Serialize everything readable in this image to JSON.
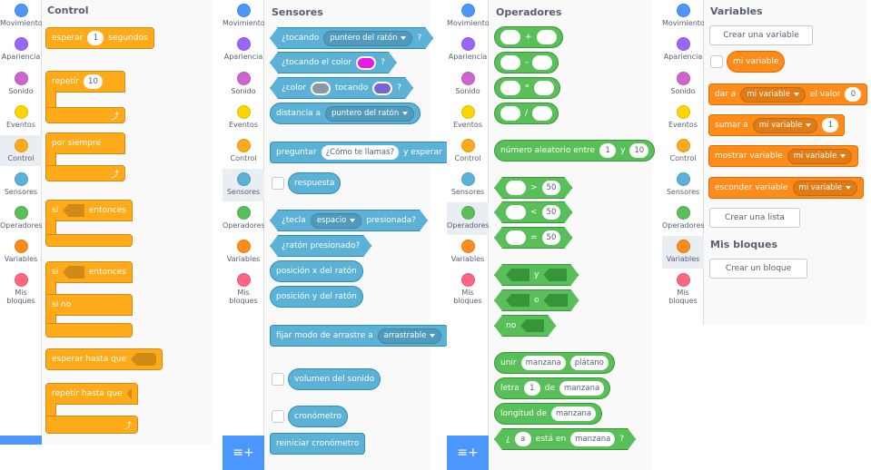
{
  "categories": [
    {
      "label": "Movimiento",
      "color": "#4c97ff"
    },
    {
      "label": "Apariencia",
      "color": "#9966ff"
    },
    {
      "label": "Sonido",
      "color": "#cf63cf"
    },
    {
      "label": "Eventos",
      "color": "#ffd500"
    },
    {
      "label": "Control",
      "color": "#ffab19"
    },
    {
      "label": "Sensores",
      "color": "#5cb1d6"
    },
    {
      "label": "Operadores",
      "color": "#59c059"
    },
    {
      "label": "Variables",
      "color": "#ff8c1a"
    },
    {
      "label": "Mis bloques",
      "color": "#ff6680"
    }
  ],
  "control": {
    "title": "Control",
    "wait_pre": "esperar",
    "wait_val": "1",
    "wait_post": "segundos",
    "repeat": "repetir",
    "repeat_val": "10",
    "forever": "por siempre",
    "if": "si",
    "then": "entonces",
    "else": "si no",
    "wait_until": "esperar hasta que",
    "repeat_until": "repetir hasta que"
  },
  "sensing": {
    "title": "Sensores",
    "touching": "¿tocando",
    "touching_dd": "puntero del ratón",
    "q": "?",
    "touching_color": "¿tocando el color",
    "color_pre": "¿color",
    "color_mid": "tocando",
    "distance": "distancia a",
    "distance_dd": "puntero del ratón",
    "ask": "preguntar",
    "ask_val": "¿Cómo te llamas?",
    "ask_post": "y esperar",
    "answer": "respuesta",
    "key": "¿tecla",
    "key_dd": "espacio",
    "key_post": "presionada?",
    "mouse_down": "¿ratón presionado?",
    "mouse_x": "posición x del ratón",
    "mouse_y": "posición y del ratón",
    "drag": "fijar modo de arrastre a",
    "drag_dd": "arrastrable",
    "loudness": "volumen del sonido",
    "timer": "cronómetro",
    "reset_timer": "reiniciar cronómetro"
  },
  "operators": {
    "title": "Operadores",
    "plus": "+",
    "minus": "-",
    "times": "*",
    "divide": "/",
    "random": "número aleatorio entre",
    "r1": "1",
    "r_and": "y",
    "r2": "10",
    "gt": ">",
    "lt": "<",
    "eq": "=",
    "fifty": "50",
    "and": "y",
    "or": "o",
    "not": "no",
    "join": "unir",
    "join1": "manzana",
    "join2": "plátano",
    "letter": "letra",
    "letter_n": "1",
    "letter_of": "de",
    "letter_w": "manzana",
    "length": "longitud de",
    "length_w": "manzana",
    "contains_pre": "¿",
    "contains_a": "a",
    "contains_mid": "está en",
    "contains_w": "manzana",
    "contains_q": "?"
  },
  "variables": {
    "title": "Variables",
    "make_var": "Crear una variable",
    "my_var": "mi variable",
    "set": "dar a",
    "set_to": "el valor",
    "set_val": "0",
    "change": "sumar a",
    "change_val": "1",
    "show": "mostrar variable",
    "hide": "esconder variable",
    "make_list": "Crear una lista",
    "my_blocks": "Mis bloques",
    "make_block": "Crear un bloque"
  }
}
